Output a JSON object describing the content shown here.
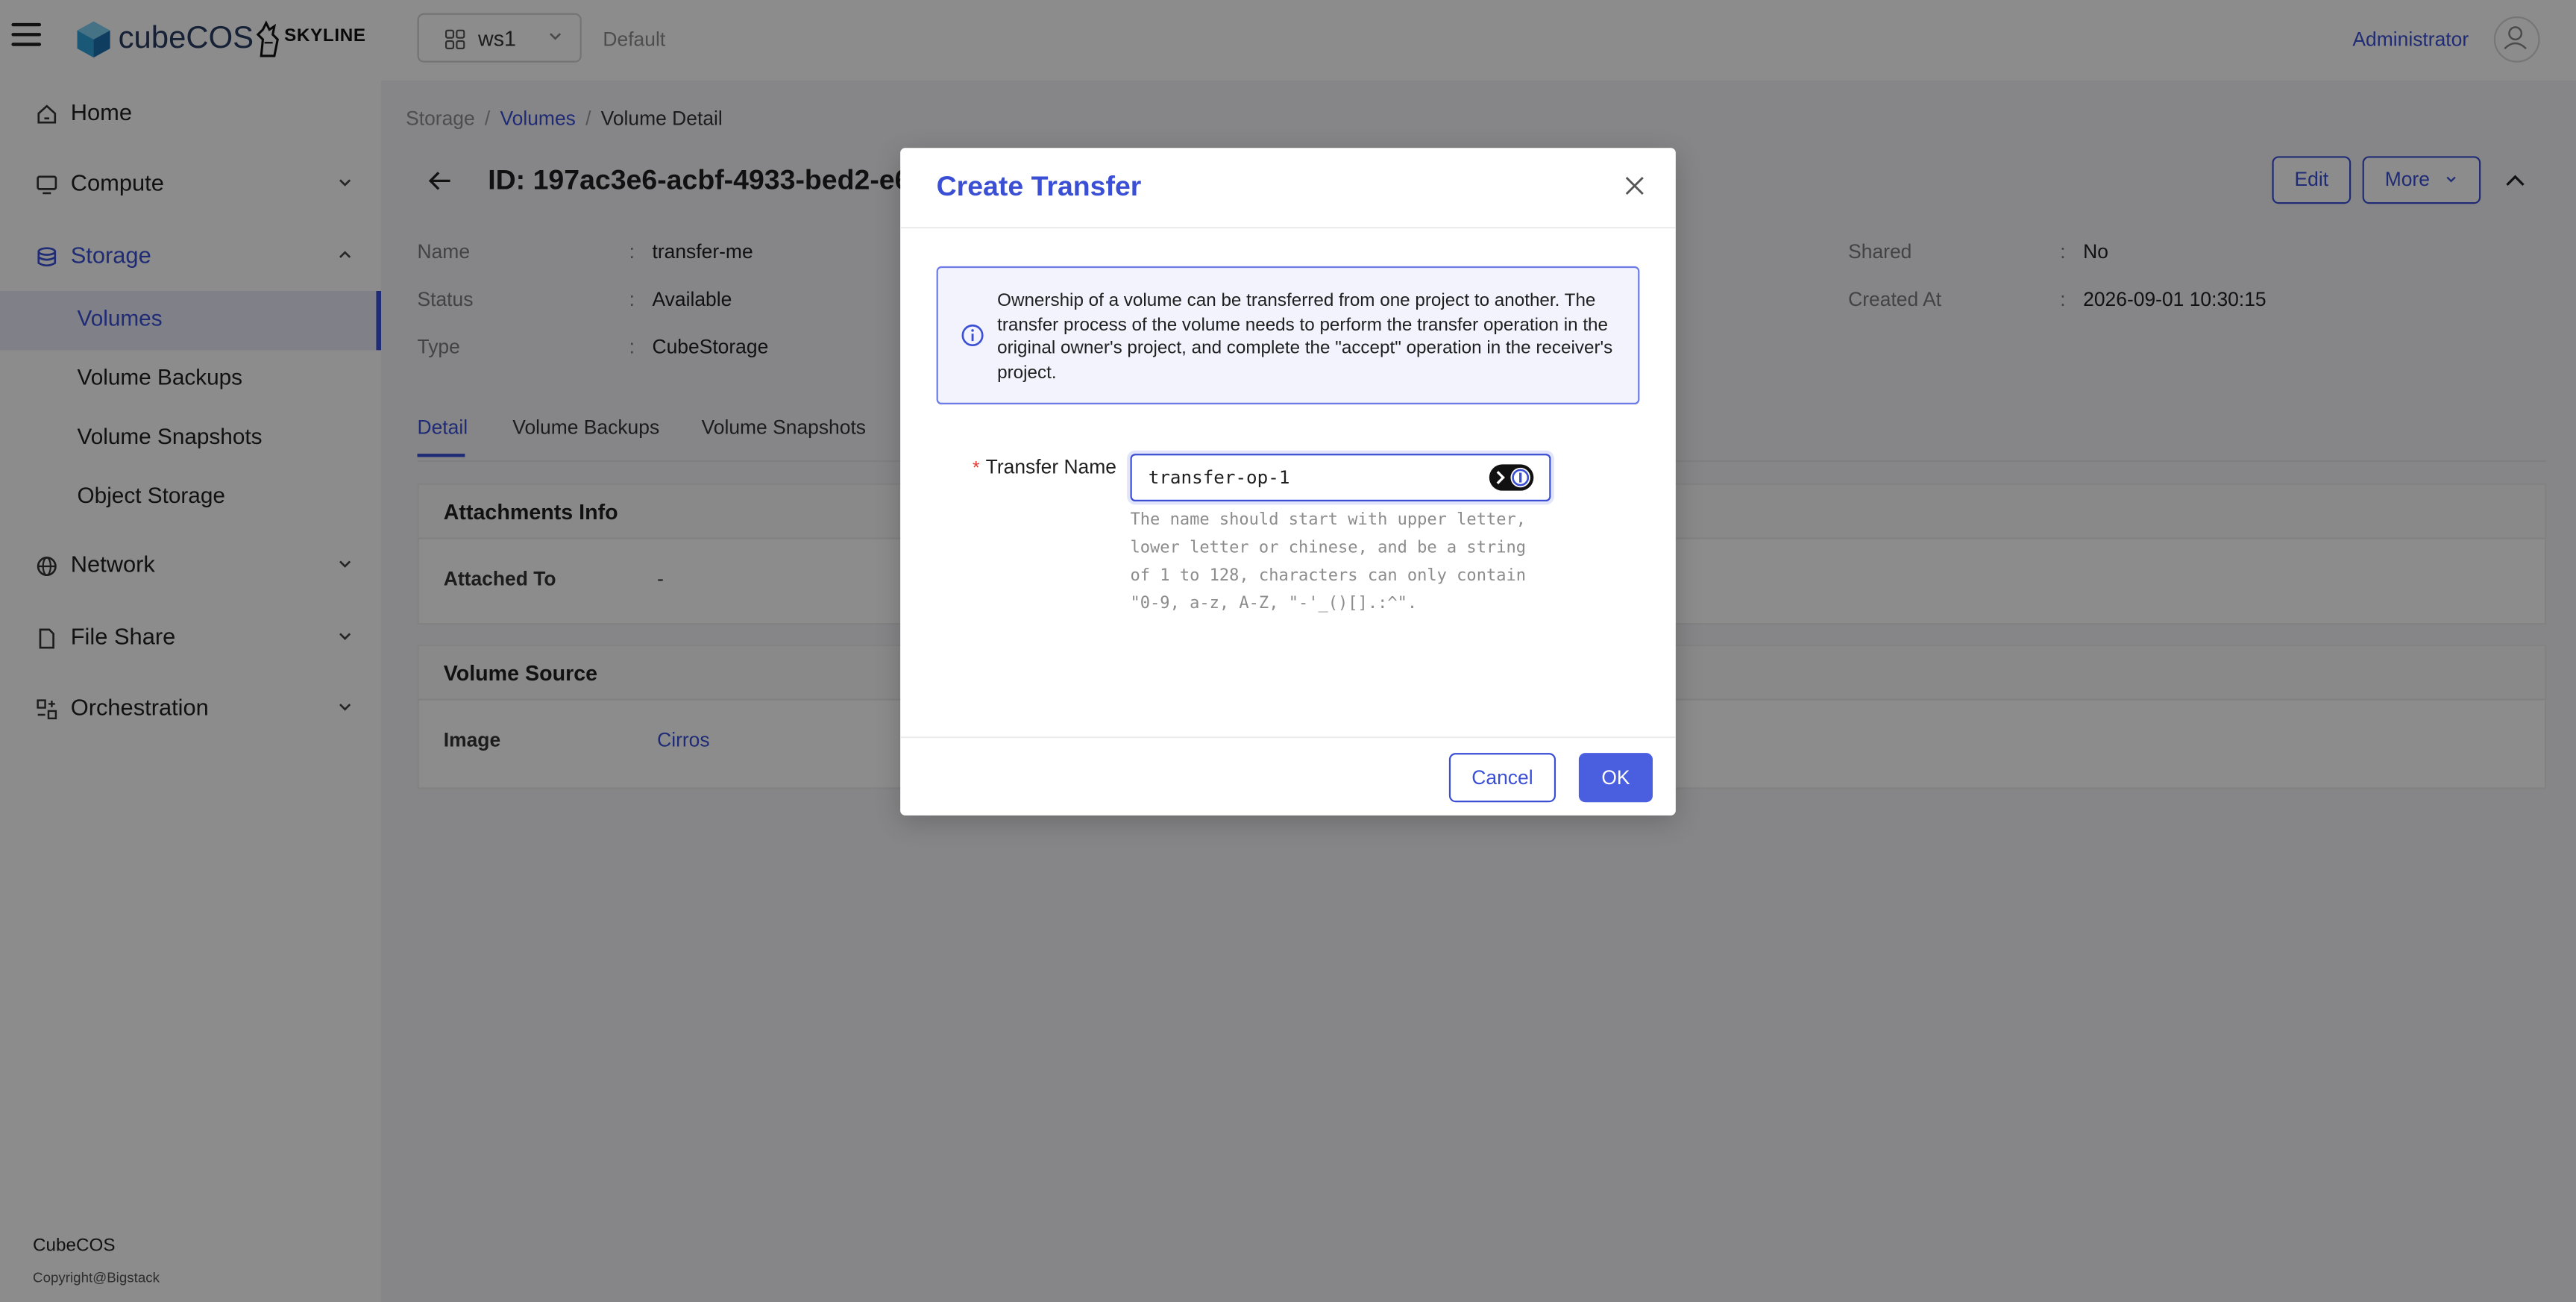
{
  "header": {
    "brand": "cubeCOS",
    "partner": "SKYLINE",
    "workspace": "ws1",
    "domain": "Default",
    "user": "Administrator"
  },
  "sidebar": {
    "items": [
      {
        "label": "Home"
      },
      {
        "label": "Compute"
      },
      {
        "label": "Storage"
      },
      {
        "label": "Network"
      },
      {
        "label": "File Share"
      },
      {
        "label": "Orchestration"
      }
    ],
    "storage_children": [
      {
        "label": "Volumes"
      },
      {
        "label": "Volume Backups"
      },
      {
        "label": "Volume Snapshots"
      },
      {
        "label": "Object Storage"
      }
    ],
    "footer_brand": "CubeCOS",
    "footer_copy": "Copyright@Bigstack"
  },
  "breadcrumb": {
    "root": "Storage",
    "parent": "Volumes",
    "current": "Volume Detail"
  },
  "detail": {
    "id_label": "ID:",
    "id_value": "197ac3e6-acbf-4933-bed2-e6",
    "edit_label": "Edit",
    "more_label": "More",
    "fields_left": [
      {
        "label": "Name",
        "value": "transfer-me"
      },
      {
        "label": "Status",
        "value": "Available"
      },
      {
        "label": "Type",
        "value": "CubeStorage"
      }
    ],
    "fields_right": [
      {
        "label": "Shared",
        "value": "No"
      },
      {
        "label": "Created At",
        "value": "2026-09-01 10:30:15"
      }
    ],
    "colon": ":",
    "tabs": [
      {
        "label": "Detail"
      },
      {
        "label": "Volume Backups"
      },
      {
        "label": "Volume Snapshots"
      }
    ],
    "attachments_title": "Attachments Info",
    "attached_to_label": "Attached To",
    "attached_to_value": "-",
    "source_title": "Volume Source",
    "image_label": "Image",
    "image_value": "Cirros"
  },
  "modal": {
    "title": "Create Transfer",
    "alert": "Ownership of a volume can be transferred from one project to another. The transfer process of the volume needs to perform the transfer operation in the original owner's project, and complete the \"accept\" operation in the receiver's project.",
    "required_mark": "*",
    "field_label": "Transfer Name",
    "field_value": "transfer-op-1",
    "help": "The name should start with upper letter, lower letter or chinese, and be a string of 1 to 128, characters can only contain \"0-9, a-z, A-Z, \"-'_()[].:^\".",
    "cancel_label": "Cancel",
    "ok_label": "OK"
  },
  "colors": {
    "accent": "#3a4fd4",
    "primary_button": "#4a5ee0",
    "logo_blue": "#2ea0d8"
  },
  "icons": [
    "menu-icon",
    "cube-logo-icon",
    "skyline-logo-icon",
    "workspace-grid-icon",
    "chevron-down-icon",
    "user-icon",
    "home-icon",
    "compute-icon",
    "storage-icon",
    "network-icon",
    "file-share-icon",
    "orchestration-icon",
    "back-arrow-icon",
    "chevron-up-icon",
    "close-icon",
    "info-icon",
    "password-manager-icon",
    "collapse-sidebar-icon"
  ]
}
